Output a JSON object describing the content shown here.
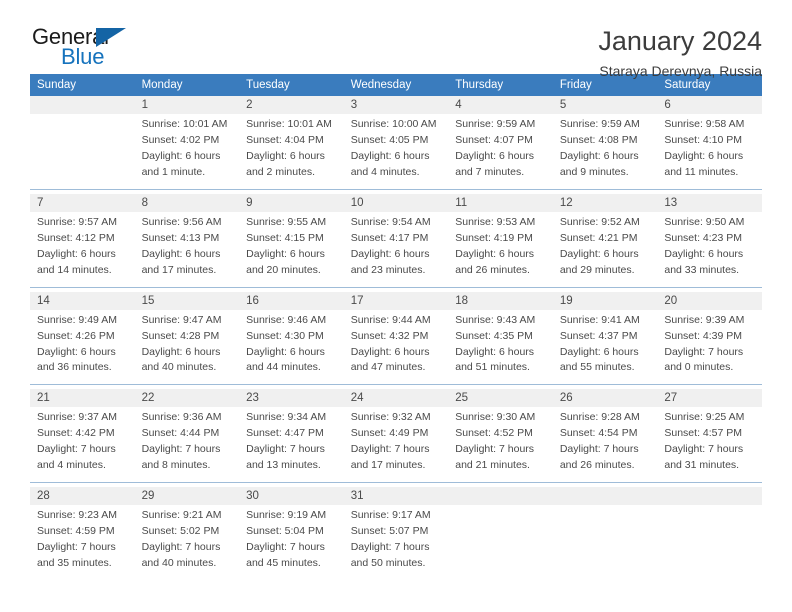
{
  "brand": {
    "name_part1": "General",
    "name_part2": "Blue",
    "accent_color": "#1673bd",
    "header_color": "#3a7cbe"
  },
  "header": {
    "title": "January 2024",
    "location": "Staraya Derevnya, Russia"
  },
  "weekday_headers": [
    "Sunday",
    "Monday",
    "Tuesday",
    "Wednesday",
    "Thursday",
    "Friday",
    "Saturday"
  ],
  "weeks": [
    [
      {
        "day": "",
        "l1": "",
        "l2": "",
        "l3": "",
        "l4": ""
      },
      {
        "day": "1",
        "l1": "Sunrise: 10:01 AM",
        "l2": "Sunset: 4:02 PM",
        "l3": "Daylight: 6 hours",
        "l4": "and 1 minute."
      },
      {
        "day": "2",
        "l1": "Sunrise: 10:01 AM",
        "l2": "Sunset: 4:04 PM",
        "l3": "Daylight: 6 hours",
        "l4": "and 2 minutes."
      },
      {
        "day": "3",
        "l1": "Sunrise: 10:00 AM",
        "l2": "Sunset: 4:05 PM",
        "l3": "Daylight: 6 hours",
        "l4": "and 4 minutes."
      },
      {
        "day": "4",
        "l1": "Sunrise: 9:59 AM",
        "l2": "Sunset: 4:07 PM",
        "l3": "Daylight: 6 hours",
        "l4": "and 7 minutes."
      },
      {
        "day": "5",
        "l1": "Sunrise: 9:59 AM",
        "l2": "Sunset: 4:08 PM",
        "l3": "Daylight: 6 hours",
        "l4": "and 9 minutes."
      },
      {
        "day": "6",
        "l1": "Sunrise: 9:58 AM",
        "l2": "Sunset: 4:10 PM",
        "l3": "Daylight: 6 hours",
        "l4": "and 11 minutes."
      }
    ],
    [
      {
        "day": "7",
        "l1": "Sunrise: 9:57 AM",
        "l2": "Sunset: 4:12 PM",
        "l3": "Daylight: 6 hours",
        "l4": "and 14 minutes."
      },
      {
        "day": "8",
        "l1": "Sunrise: 9:56 AM",
        "l2": "Sunset: 4:13 PM",
        "l3": "Daylight: 6 hours",
        "l4": "and 17 minutes."
      },
      {
        "day": "9",
        "l1": "Sunrise: 9:55 AM",
        "l2": "Sunset: 4:15 PM",
        "l3": "Daylight: 6 hours",
        "l4": "and 20 minutes."
      },
      {
        "day": "10",
        "l1": "Sunrise: 9:54 AM",
        "l2": "Sunset: 4:17 PM",
        "l3": "Daylight: 6 hours",
        "l4": "and 23 minutes."
      },
      {
        "day": "11",
        "l1": "Sunrise: 9:53 AM",
        "l2": "Sunset: 4:19 PM",
        "l3": "Daylight: 6 hours",
        "l4": "and 26 minutes."
      },
      {
        "day": "12",
        "l1": "Sunrise: 9:52 AM",
        "l2": "Sunset: 4:21 PM",
        "l3": "Daylight: 6 hours",
        "l4": "and 29 minutes."
      },
      {
        "day": "13",
        "l1": "Sunrise: 9:50 AM",
        "l2": "Sunset: 4:23 PM",
        "l3": "Daylight: 6 hours",
        "l4": "and 33 minutes."
      }
    ],
    [
      {
        "day": "14",
        "l1": "Sunrise: 9:49 AM",
        "l2": "Sunset: 4:26 PM",
        "l3": "Daylight: 6 hours",
        "l4": "and 36 minutes."
      },
      {
        "day": "15",
        "l1": "Sunrise: 9:47 AM",
        "l2": "Sunset: 4:28 PM",
        "l3": "Daylight: 6 hours",
        "l4": "and 40 minutes."
      },
      {
        "day": "16",
        "l1": "Sunrise: 9:46 AM",
        "l2": "Sunset: 4:30 PM",
        "l3": "Daylight: 6 hours",
        "l4": "and 44 minutes."
      },
      {
        "day": "17",
        "l1": "Sunrise: 9:44 AM",
        "l2": "Sunset: 4:32 PM",
        "l3": "Daylight: 6 hours",
        "l4": "and 47 minutes."
      },
      {
        "day": "18",
        "l1": "Sunrise: 9:43 AM",
        "l2": "Sunset: 4:35 PM",
        "l3": "Daylight: 6 hours",
        "l4": "and 51 minutes."
      },
      {
        "day": "19",
        "l1": "Sunrise: 9:41 AM",
        "l2": "Sunset: 4:37 PM",
        "l3": "Daylight: 6 hours",
        "l4": "and 55 minutes."
      },
      {
        "day": "20",
        "l1": "Sunrise: 9:39 AM",
        "l2": "Sunset: 4:39 PM",
        "l3": "Daylight: 7 hours",
        "l4": "and 0 minutes."
      }
    ],
    [
      {
        "day": "21",
        "l1": "Sunrise: 9:37 AM",
        "l2": "Sunset: 4:42 PM",
        "l3": "Daylight: 7 hours",
        "l4": "and 4 minutes."
      },
      {
        "day": "22",
        "l1": "Sunrise: 9:36 AM",
        "l2": "Sunset: 4:44 PM",
        "l3": "Daylight: 7 hours",
        "l4": "and 8 minutes."
      },
      {
        "day": "23",
        "l1": "Sunrise: 9:34 AM",
        "l2": "Sunset: 4:47 PM",
        "l3": "Daylight: 7 hours",
        "l4": "and 13 minutes."
      },
      {
        "day": "24",
        "l1": "Sunrise: 9:32 AM",
        "l2": "Sunset: 4:49 PM",
        "l3": "Daylight: 7 hours",
        "l4": "and 17 minutes."
      },
      {
        "day": "25",
        "l1": "Sunrise: 9:30 AM",
        "l2": "Sunset: 4:52 PM",
        "l3": "Daylight: 7 hours",
        "l4": "and 21 minutes."
      },
      {
        "day": "26",
        "l1": "Sunrise: 9:28 AM",
        "l2": "Sunset: 4:54 PM",
        "l3": "Daylight: 7 hours",
        "l4": "and 26 minutes."
      },
      {
        "day": "27",
        "l1": "Sunrise: 9:25 AM",
        "l2": "Sunset: 4:57 PM",
        "l3": "Daylight: 7 hours",
        "l4": "and 31 minutes."
      }
    ],
    [
      {
        "day": "28",
        "l1": "Sunrise: 9:23 AM",
        "l2": "Sunset: 4:59 PM",
        "l3": "Daylight: 7 hours",
        "l4": "and 35 minutes."
      },
      {
        "day": "29",
        "l1": "Sunrise: 9:21 AM",
        "l2": "Sunset: 5:02 PM",
        "l3": "Daylight: 7 hours",
        "l4": "and 40 minutes."
      },
      {
        "day": "30",
        "l1": "Sunrise: 9:19 AM",
        "l2": "Sunset: 5:04 PM",
        "l3": "Daylight: 7 hours",
        "l4": "and 45 minutes."
      },
      {
        "day": "31",
        "l1": "Sunrise: 9:17 AM",
        "l2": "Sunset: 5:07 PM",
        "l3": "Daylight: 7 hours",
        "l4": "and 50 minutes."
      },
      {
        "day": "",
        "l1": "",
        "l2": "",
        "l3": "",
        "l4": ""
      },
      {
        "day": "",
        "l1": "",
        "l2": "",
        "l3": "",
        "l4": ""
      },
      {
        "day": "",
        "l1": "",
        "l2": "",
        "l3": "",
        "l4": ""
      }
    ]
  ]
}
